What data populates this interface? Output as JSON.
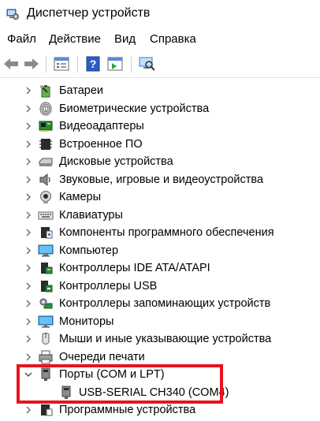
{
  "window": {
    "title": "Диспетчер устройств"
  },
  "menu": [
    "Файл",
    "Действие",
    "Вид",
    "Справка"
  ],
  "toolbar": {
    "buttons": [
      "back-arrow-icon",
      "forward-arrow-icon",
      "properties-icon",
      "help-icon",
      "update-driver-icon",
      "scan-hardware-icon"
    ]
  },
  "tree": {
    "categories": [
      {
        "label": "Батареи",
        "icon": "battery-icon"
      },
      {
        "label": "Биометрические устройства",
        "icon": "fingerprint-icon"
      },
      {
        "label": "Видеоадаптеры",
        "icon": "display-adapter-icon"
      },
      {
        "label": "Встроенное ПО",
        "icon": "firmware-chip-icon"
      },
      {
        "label": "Дисковые устройства",
        "icon": "disk-drive-icon"
      },
      {
        "label": "Звуковые, игровые и видеоустройства",
        "icon": "speaker-icon"
      },
      {
        "label": "Камеры",
        "icon": "camera-icon"
      },
      {
        "label": "Клавиатуры",
        "icon": "keyboard-icon"
      },
      {
        "label": "Компоненты программного обеспечения",
        "icon": "software-component-icon"
      },
      {
        "label": "Компьютер",
        "icon": "computer-icon"
      },
      {
        "label": "Контроллеры IDE ATA/ATAPI",
        "icon": "ide-controller-icon"
      },
      {
        "label": "Контроллеры USB",
        "icon": "usb-controller-icon"
      },
      {
        "label": "Контроллеры запоминающих устройств",
        "icon": "storage-controller-icon"
      },
      {
        "label": "Мониторы",
        "icon": "monitor-icon"
      },
      {
        "label": "Мыши и иные указывающие устройства",
        "icon": "mouse-icon"
      },
      {
        "label": "Очереди печати",
        "icon": "printer-icon"
      },
      {
        "label": "Порты (COM и LPT)",
        "icon": "port-icon",
        "expanded": true,
        "children": [
          {
            "label": "USB-SERIAL CH340 (COM4)",
            "icon": "port-device-icon"
          }
        ]
      },
      {
        "label": "Программные устройства",
        "icon": "software-device-icon"
      }
    ]
  },
  "colors": {
    "highlight_border": "#e5141f",
    "accent_blue": "#2b6fd6"
  }
}
